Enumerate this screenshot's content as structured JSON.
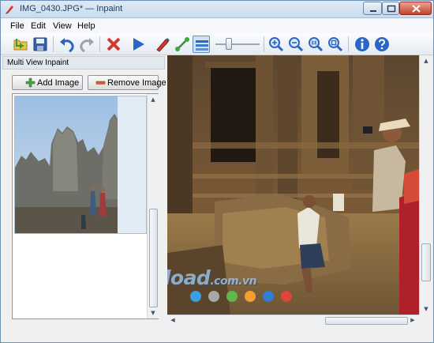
{
  "window": {
    "title": "IMG_0430.JPG* — Inpaint"
  },
  "menu": [
    "File",
    "Edit",
    "View",
    "Help"
  ],
  "toolbar": {
    "buttons": [
      "open-icon",
      "save-icon",
      "undo-icon",
      "redo-icon",
      "cancel-icon",
      "run-icon",
      "marker-icon",
      "line-icon",
      "stack-icon",
      "zoom-in-icon",
      "zoom-out-icon",
      "zoom-actual-icon",
      "zoom-fit-icon",
      "info-icon",
      "help-icon"
    ],
    "brush_size": 0.35
  },
  "panel": {
    "title": "Multi View Inpaint",
    "add_image": "Add Image",
    "remove_image": "Remove Image"
  },
  "watermark": {
    "brand": "Download",
    "suffix": ".com.vn",
    "dot_colors": [
      "#3a9ee0",
      "#a8a8a8",
      "#5fb84a",
      "#f2a033",
      "#2f7fd6",
      "#e0453a"
    ]
  },
  "colors": {
    "accent_blue": "#2a66c4",
    "cancel_red": "#d23a30",
    "add_green": "#3fa63f",
    "remove_red": "#d85a2e"
  }
}
